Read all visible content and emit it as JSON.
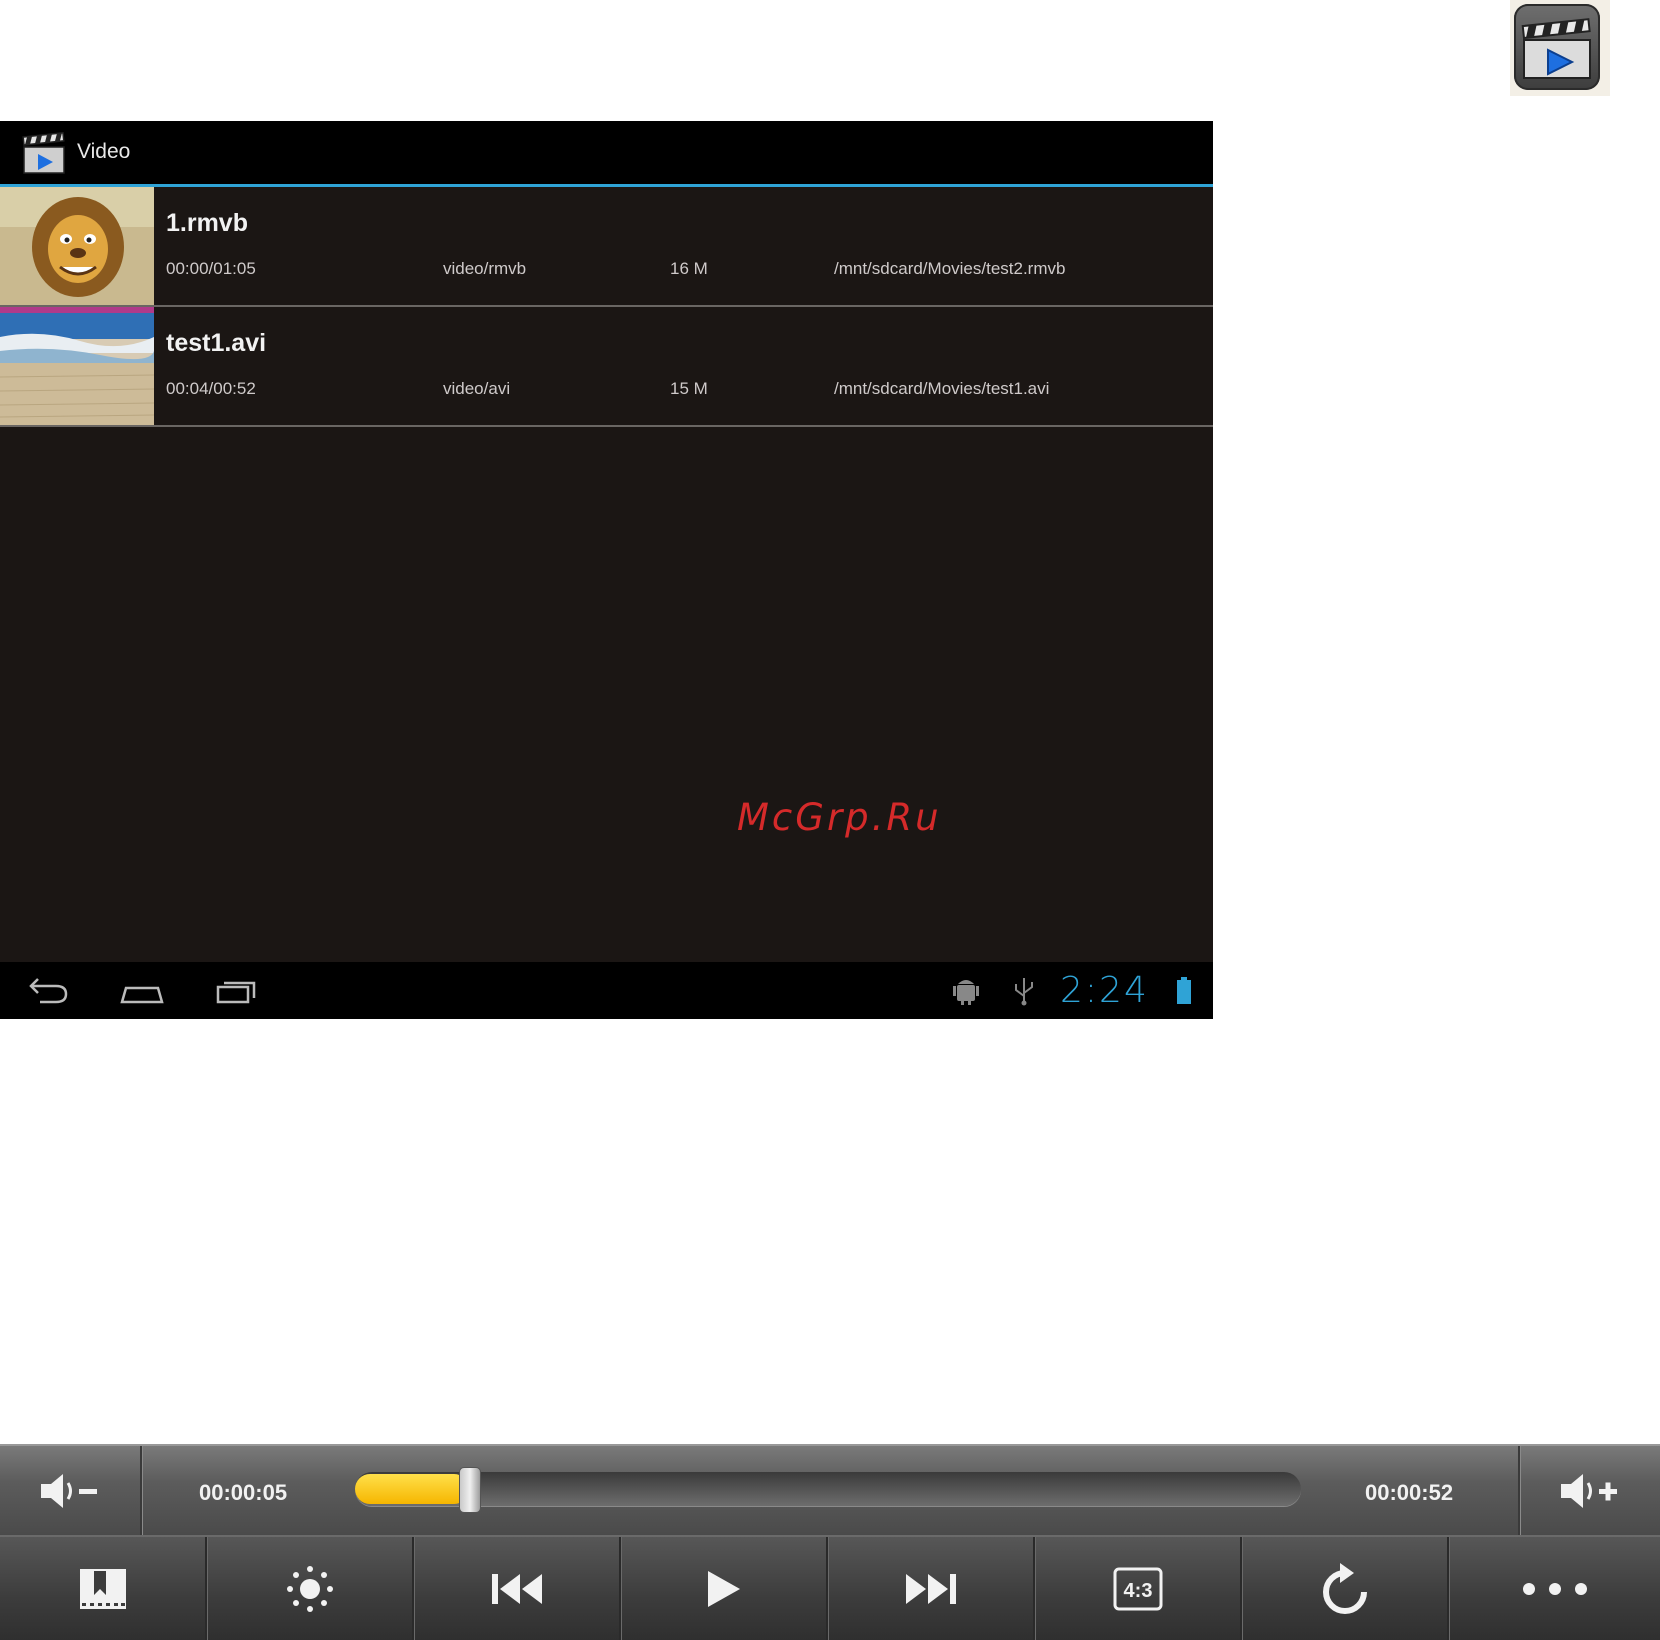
{
  "app": {
    "title": "Video"
  },
  "files": [
    {
      "name": "1.rmvb",
      "duration": "00:00/01:05",
      "mime": "video/rmvb",
      "size": "16 M",
      "path": "/mnt/sdcard/Movies/test2.rmvb"
    },
    {
      "name": "test1.avi",
      "duration": "00:04/00:52",
      "mime": "video/avi",
      "size": "15 M",
      "path": "/mnt/sdcard/Movies/test1.avi"
    }
  ],
  "watermark": "McGrp.Ru",
  "status_bar": {
    "clock": "2:24"
  },
  "nav_icons": [
    "back-icon",
    "home-icon",
    "recents-icon"
  ],
  "status_icons": [
    "android-debug-icon",
    "usb-icon",
    "battery-icon"
  ],
  "player": {
    "elapsed": "00:00:05",
    "total": "00:00:52",
    "progress": 0.12,
    "aspect_label": "4:3",
    "buttons": [
      "bookmark-icon",
      "brightness-icon",
      "previous-icon",
      "play-icon",
      "next-icon",
      "aspect-ratio-icon",
      "replay-icon",
      "more-icon"
    ]
  },
  "colors": {
    "accent": "#2fa3d6",
    "progress": "#f6b600",
    "watermark": "#d52a2a"
  }
}
